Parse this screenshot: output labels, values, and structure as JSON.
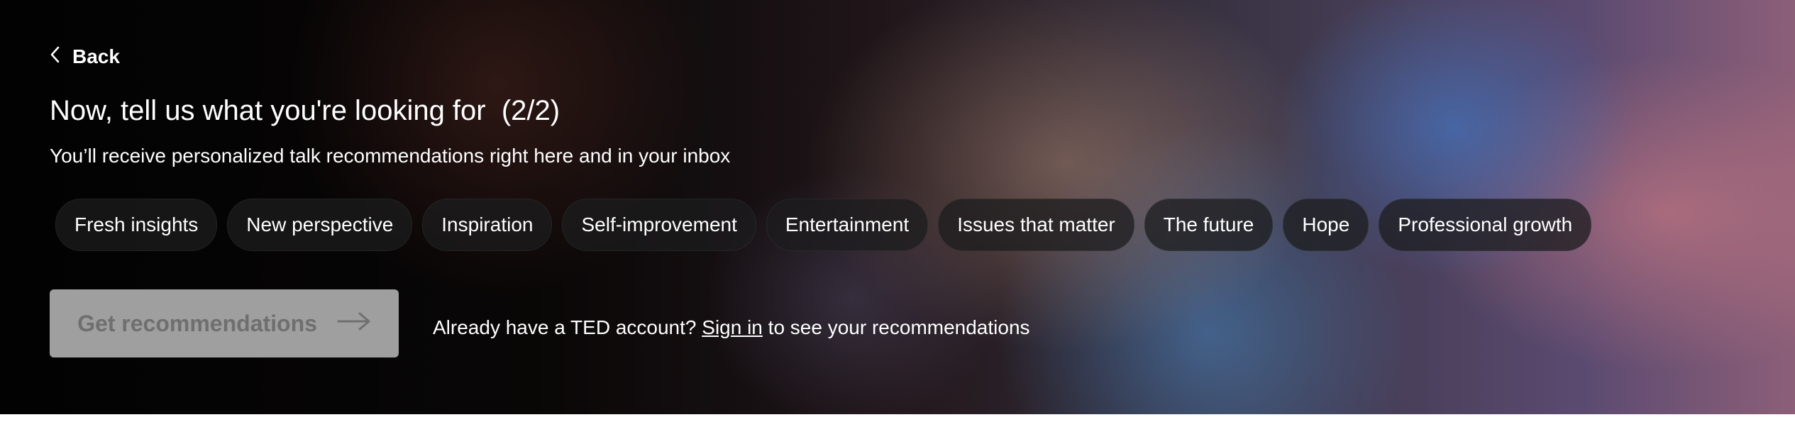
{
  "nav": {
    "back_label": "Back"
  },
  "header": {
    "title": "Now, tell us what you're looking for",
    "step": "(2/2)",
    "subtitle": "You’ll receive personalized talk recommendations right here and in your inbox"
  },
  "chips": [
    "Fresh insights",
    "New perspective",
    "Inspiration",
    "Self-improvement",
    "Entertainment",
    "Issues that matter",
    "The future",
    "Hope",
    "Professional growth"
  ],
  "cta": {
    "label": "Get recommendations",
    "state": "disabled",
    "bg_color": "#9f9f9f"
  },
  "signin": {
    "prefix": "Already have a TED account?",
    "link": "Sign in",
    "suffix": "to see your recommendations"
  },
  "icons": {
    "back": "chevron-left-icon",
    "cta": "arrow-right-icon"
  }
}
